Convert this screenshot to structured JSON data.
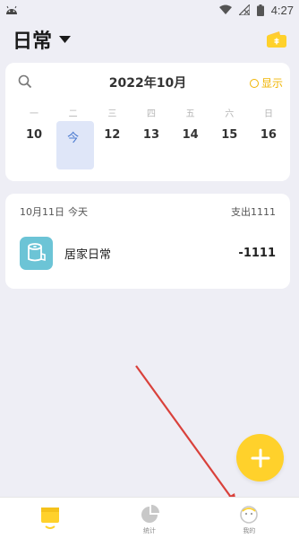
{
  "status_bar": {
    "time": "4:27"
  },
  "header": {
    "book_title": "日常"
  },
  "calendar": {
    "month_title": "2022年10月",
    "show_label": "显示",
    "weekdays": [
      "一",
      "二",
      "三",
      "四",
      "五",
      "六",
      "日"
    ],
    "days": [
      "10",
      "今",
      "12",
      "13",
      "14",
      "15",
      "16"
    ]
  },
  "records": {
    "date": "10月11日",
    "day_label": "今天",
    "expense_summary": "支出1111",
    "items": [
      {
        "category": "居家日常",
        "amount": "-1111",
        "icon": "home-roll-icon"
      }
    ]
  },
  "bottom_nav": {
    "items": [
      {
        "label": "",
        "icon": "ledger-icon"
      },
      {
        "label": "统计",
        "icon": "pie-chart-icon"
      },
      {
        "label": "我的",
        "icon": "profile-icon"
      }
    ]
  },
  "colors": {
    "accent": "#ffd12b",
    "accent_text": "#f0b400",
    "category_bg": "#6cc4d6",
    "today_bg": "#dfe6f8",
    "annotation": "#d9413b"
  }
}
